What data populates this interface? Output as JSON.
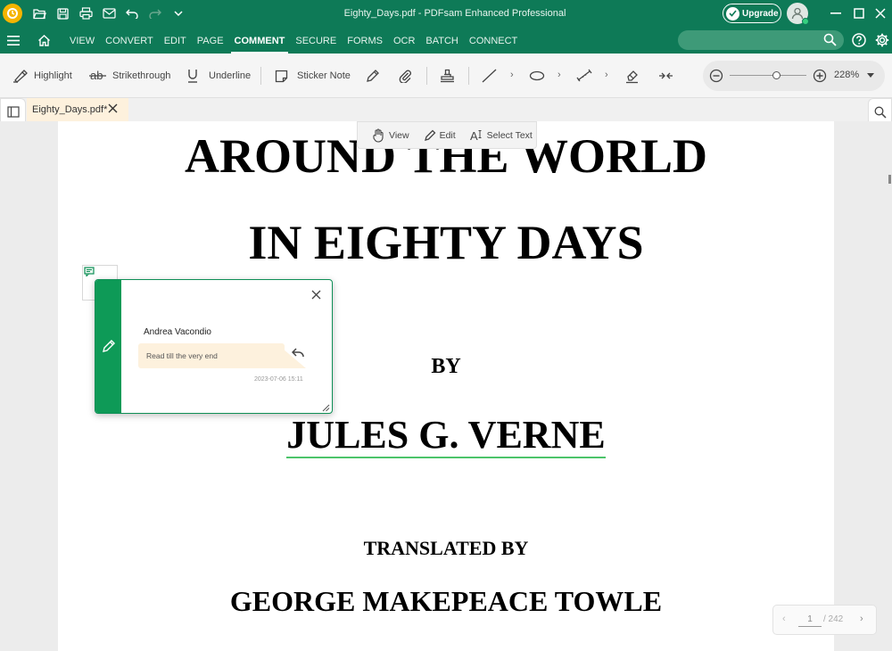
{
  "titlebar": {
    "title": "Eighty_Days.pdf  -  PDFsam Enhanced Professional",
    "upgrade_label": "Upgrade"
  },
  "menu": {
    "items": [
      "VIEW",
      "CONVERT",
      "EDIT",
      "PAGE",
      "COMMENT",
      "SECURE",
      "FORMS",
      "OCR",
      "BATCH",
      "CONNECT"
    ],
    "active": "COMMENT",
    "search_placeholder": ""
  },
  "ribbon": {
    "highlight": "Highlight",
    "strikethrough": "Strikethrough",
    "underline": "Underline",
    "sticker_note": "Sticker Note",
    "zoom_level": "228%"
  },
  "tab": {
    "label": "Eighty_Days.pdf*"
  },
  "modes": {
    "view": "View",
    "edit": "Edit",
    "select_text": "Select Text"
  },
  "document": {
    "line1": "AROUND THE WORLD",
    "line2": "IN EIGHTY DAYS",
    "line3": "BY",
    "line4": "JULES G. VERNE",
    "line5": "TRANSLATED BY",
    "line6": "GEORGE MAKEPEACE TOWLE"
  },
  "note": {
    "author": "Andrea Vacondio",
    "text": "Read till the very end",
    "timestamp": "2023-07-06 15:11"
  },
  "pagenav": {
    "current": "1",
    "total": "/ 242"
  },
  "colors": {
    "brand": "#0e7a57",
    "note_strip": "#0e9a57",
    "note_bubble": "#fdf1dd",
    "underline_accent": "#4cc46a"
  }
}
